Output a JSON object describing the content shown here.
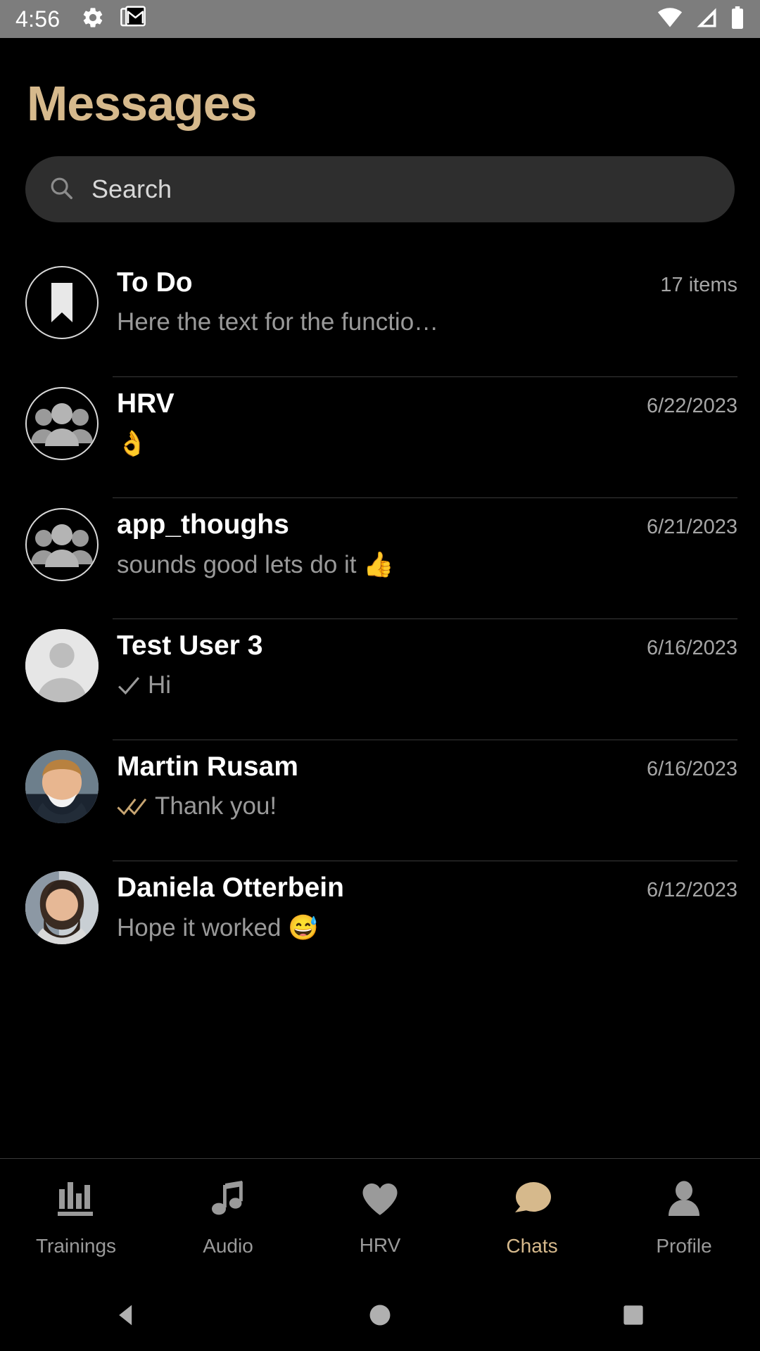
{
  "status_bar": {
    "time": "4:56",
    "left_icons": [
      "settings-gear-icon",
      "gmail-icon"
    ],
    "right_icons": [
      "wifi-icon",
      "cellular-signal-icon",
      "battery-icon"
    ]
  },
  "header": {
    "title": "Messages",
    "accent_color": "#d6b98c"
  },
  "search": {
    "placeholder": "Search",
    "value": "",
    "icon": "search-icon"
  },
  "chats": [
    {
      "name": "To Do",
      "meta": "17 items",
      "preview": "Here the text for the functio…",
      "avatar_type": "bookmark",
      "tick": "none"
    },
    {
      "name": "HRV",
      "meta": "6/22/2023",
      "preview": "👌",
      "avatar_type": "group",
      "tick": "none"
    },
    {
      "name": "app_thoughs",
      "meta": "6/21/2023",
      "preview": "sounds good lets do it 👍",
      "avatar_type": "group",
      "tick": "none"
    },
    {
      "name": "Test User 3",
      "meta": "6/16/2023",
      "preview": "Hi",
      "avatar_type": "person",
      "tick": "single"
    },
    {
      "name": "Martin Rusam",
      "meta": "6/16/2023",
      "preview": "Thank you!",
      "avatar_type": "photo-male",
      "tick": "double"
    },
    {
      "name": "Daniela Otterbein",
      "meta": "6/12/2023",
      "preview": "Hope it worked 😅",
      "avatar_type": "photo-female",
      "tick": "none"
    }
  ],
  "tabs": [
    {
      "label": "Trainings",
      "icon": "bar-chart-icon",
      "active": false
    },
    {
      "label": "Audio",
      "icon": "music-note-icon",
      "active": false
    },
    {
      "label": "HRV",
      "icon": "heart-icon",
      "active": false
    },
    {
      "label": "Chats",
      "icon": "speech-bubble-icon",
      "active": true
    },
    {
      "label": "Profile",
      "icon": "person-icon",
      "active": false
    }
  ],
  "nav_bar": {
    "back": "back-triangle-icon",
    "home": "home-circle-icon",
    "recents": "recents-square-icon"
  }
}
